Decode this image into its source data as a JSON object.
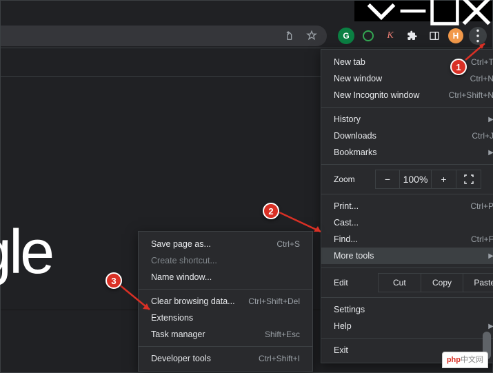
{
  "window": {
    "avatar_letter": "H"
  },
  "page": {
    "logo_fragment": "ogle"
  },
  "menu": {
    "new_tab": "New tab",
    "new_tab_sc": "Ctrl+T",
    "new_window": "New window",
    "new_window_sc": "Ctrl+N",
    "incognito": "New Incognito window",
    "incognito_sc": "Ctrl+Shift+N",
    "history": "History",
    "downloads": "Downloads",
    "downloads_sc": "Ctrl+J",
    "bookmarks": "Bookmarks",
    "zoom": "Zoom",
    "zoom_minus": "−",
    "zoom_val": "100%",
    "zoom_plus": "+",
    "print": "Print...",
    "print_sc": "Ctrl+P",
    "cast": "Cast...",
    "find": "Find...",
    "find_sc": "Ctrl+F",
    "more_tools": "More tools",
    "edit": "Edit",
    "cut": "Cut",
    "copy": "Copy",
    "paste": "Paste",
    "settings": "Settings",
    "help": "Help",
    "exit": "Exit"
  },
  "submenu": {
    "save_page": "Save page as...",
    "save_page_sc": "Ctrl+S",
    "create_shortcut": "Create shortcut...",
    "name_window": "Name window...",
    "clear_data": "Clear browsing data...",
    "clear_data_sc": "Ctrl+Shift+Del",
    "extensions": "Extensions",
    "task_manager": "Task manager",
    "task_manager_sc": "Shift+Esc",
    "dev_tools": "Developer tools",
    "dev_tools_sc": "Ctrl+Shift+I"
  },
  "callouts": {
    "c1": "1",
    "c2": "2",
    "c3": "3"
  },
  "watermark": {
    "brand": "php",
    "suffix": "中文网"
  }
}
